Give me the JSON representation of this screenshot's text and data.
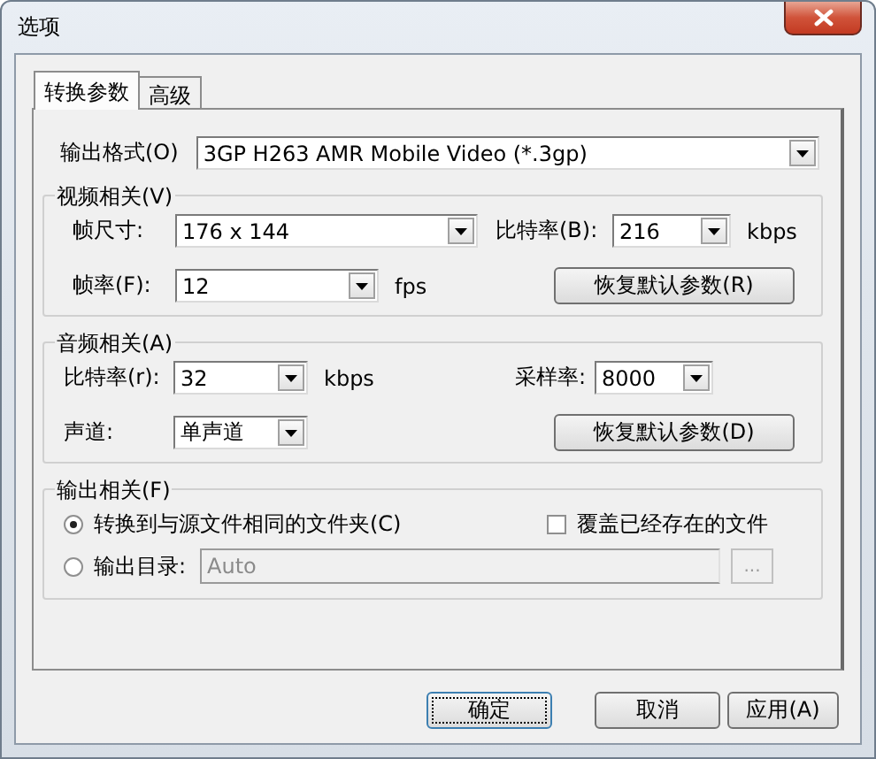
{
  "window": {
    "title": "选项"
  },
  "tabs": [
    {
      "label": "转换参数",
      "selected": true
    },
    {
      "label": "高级",
      "selected": false
    }
  ],
  "output_format": {
    "label": "输出格式(O)",
    "value": "3GP H263 AMR Mobile Video (*.3gp)"
  },
  "video": {
    "legend": "视频相关(V)",
    "frame_size": {
      "label": "帧尺寸:",
      "value": "176 x 144"
    },
    "bitrate": {
      "label": "比特率(B):",
      "value": "216",
      "unit": "kbps"
    },
    "frame_rate": {
      "label": "帧率(F):",
      "value": "12",
      "unit": "fps"
    },
    "reset_button": "恢复默认参数(R)"
  },
  "audio": {
    "legend": "音频相关(A)",
    "bitrate": {
      "label": "比特率(r):",
      "value": "32",
      "unit": "kbps"
    },
    "sample_rate": {
      "label": "采样率:",
      "value": "8000"
    },
    "channels": {
      "label": "声道:",
      "value": "单声道"
    },
    "reset_button": "恢复默认参数(D)"
  },
  "output": {
    "legend": "输出相关(F)",
    "destinations": [
      {
        "label": "转换到与源文件相同的文件夹(C)",
        "selected": true
      },
      {
        "label": "输出目录:",
        "selected": false
      }
    ],
    "directory": {
      "value": "Auto",
      "disabled": true
    },
    "browse_button": "...",
    "overwrite": {
      "label": "覆盖已经存在的文件",
      "checked": false
    }
  },
  "buttons": [
    {
      "label": "确定",
      "focused": true
    },
    {
      "label": "取消",
      "focused": false
    },
    {
      "label": "应用(A)",
      "focused": false
    }
  ]
}
